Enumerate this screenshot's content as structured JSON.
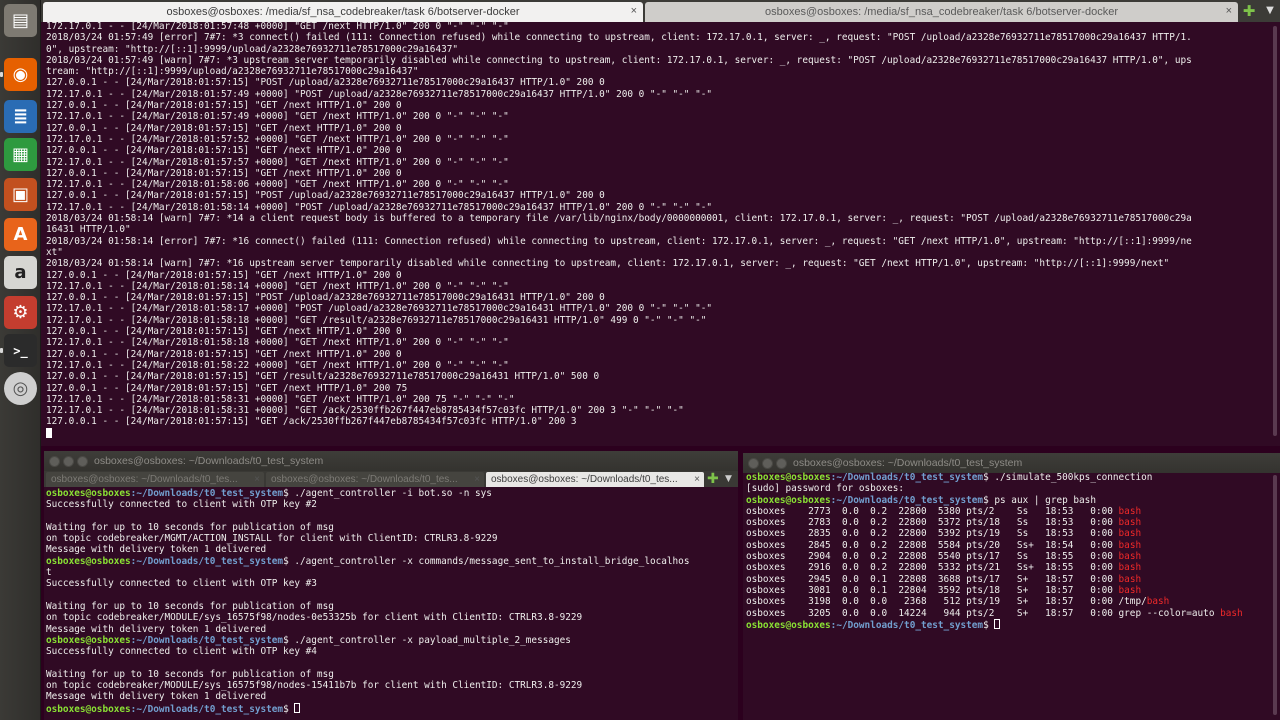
{
  "launcher": {
    "items": [
      {
        "icon": "file-manager-icon",
        "color": "#7e7a72",
        "glyph": "▤"
      },
      {
        "icon": "firefox-icon",
        "color": "#e66000",
        "glyph": "◉"
      },
      {
        "icon": "writer-icon",
        "color": "#2a6cb4",
        "glyph": "≣"
      },
      {
        "icon": "calc-icon",
        "color": "#2e9a3f",
        "glyph": "▦"
      },
      {
        "icon": "impress-icon",
        "color": "#c2501f",
        "glyph": "▣"
      },
      {
        "icon": "software-center-icon",
        "color": "#e8641b",
        "glyph": "A"
      },
      {
        "icon": "amazon-icon",
        "color": "#d6d6d2",
        "glyph": "a"
      },
      {
        "icon": "system-settings-icon",
        "color": "#c43d2f",
        "glyph": "⚙"
      },
      {
        "icon": "terminal-icon",
        "color": "#2b2b2b",
        "glyph": ">_"
      },
      {
        "icon": "dvd-icon",
        "color": "#cfcfcf",
        "glyph": "◎"
      }
    ]
  },
  "top_window": {
    "tabs": [
      {
        "label": "osboxes@osboxes: /media/sf_nsa_codebreaker/task 6/botserver-docker",
        "close": "×"
      },
      {
        "label": "osboxes@osboxes: /media/sf_nsa_codebreaker/task 6/botserver-docker",
        "close": "×"
      }
    ],
    "add_glyph": "✚",
    "menu_glyph": "▼",
    "lines": [
      "172.17.0.1 - - [24/Mar/2018:01:57:48 +0000] \"GET /next HTTP/1.0\" 200 0 \"-\" \"-\" \"-\"",
      "2018/03/24 01:57:49 [error] 7#7: *3 connect() failed (111: Connection refused) while connecting to upstream, client: 172.17.0.1, server: _, request: \"POST /upload/a2328e76932711e78517000c29a16437 HTTP/1.",
      "0\", upstream: \"http://[::1]:9999/upload/a2328e76932711e78517000c29a16437\"",
      "2018/03/24 01:57:49 [warn] 7#7: *3 upstream server temporarily disabled while connecting to upstream, client: 172.17.0.1, server: _, request: \"POST /upload/a2328e76932711e78517000c29a16437 HTTP/1.0\", ups",
      "tream: \"http://[::1]:9999/upload/a2328e76932711e78517000c29a16437\"",
      "127.0.0.1 - - [24/Mar/2018:01:57:15] \"POST /upload/a2328e76932711e78517000c29a16437 HTTP/1.0\" 200 0",
      "172.17.0.1 - - [24/Mar/2018:01:57:49 +0000] \"POST /upload/a2328e76932711e78517000c29a16437 HTTP/1.0\" 200 0 \"-\" \"-\" \"-\"",
      "127.0.0.1 - - [24/Mar/2018:01:57:15] \"GET /next HTTP/1.0\" 200 0",
      "172.17.0.1 - - [24/Mar/2018:01:57:49 +0000] \"GET /next HTTP/1.0\" 200 0 \"-\" \"-\" \"-\"",
      "127.0.0.1 - - [24/Mar/2018:01:57:15] \"GET /next HTTP/1.0\" 200 0",
      "172.17.0.1 - - [24/Mar/2018:01:57:52 +0000] \"GET /next HTTP/1.0\" 200 0 \"-\" \"-\" \"-\"",
      "127.0.0.1 - - [24/Mar/2018:01:57:15] \"GET /next HTTP/1.0\" 200 0",
      "172.17.0.1 - - [24/Mar/2018:01:57:57 +0000] \"GET /next HTTP/1.0\" 200 0 \"-\" \"-\" \"-\"",
      "127.0.0.1 - - [24/Mar/2018:01:57:15] \"GET /next HTTP/1.0\" 200 0",
      "172.17.0.1 - - [24/Mar/2018:01:58:06 +0000] \"GET /next HTTP/1.0\" 200 0 \"-\" \"-\" \"-\"",
      "127.0.0.1 - - [24/Mar/2018:01:57:15] \"POST /upload/a2328e76932711e78517000c29a16437 HTTP/1.0\" 200 0",
      "172.17.0.1 - - [24/Mar/2018:01:58:14 +0000] \"POST /upload/a2328e76932711e78517000c29a16437 HTTP/1.0\" 200 0 \"-\" \"-\" \"-\"",
      "2018/03/24 01:58:14 [warn] 7#7: *14 a client request body is buffered to a temporary file /var/lib/nginx/body/0000000001, client: 172.17.0.1, server: _, request: \"POST /upload/a2328e76932711e78517000c29a",
      "16431 HTTP/1.0\"",
      "2018/03/24 01:58:14 [error] 7#7: *16 connect() failed (111: Connection refused) while connecting to upstream, client: 172.17.0.1, server: _, request: \"GET /next HTTP/1.0\", upstream: \"http://[::1]:9999/ne",
      "xt\"",
      "2018/03/24 01:58:14 [warn] 7#7: *16 upstream server temporarily disabled while connecting to upstream, client: 172.17.0.1, server: _, request: \"GET /next HTTP/1.0\", upstream: \"http://[::1]:9999/next\"",
      "127.0.0.1 - - [24/Mar/2018:01:57:15] \"GET /next HTTP/1.0\" 200 0",
      "172.17.0.1 - - [24/Mar/2018:01:58:14 +0000] \"GET /next HTTP/1.0\" 200 0 \"-\" \"-\" \"-\"",
      "127.0.0.1 - - [24/Mar/2018:01:57:15] \"POST /upload/a2328e76932711e78517000c29a16431 HTTP/1.0\" 200 0",
      "172.17.0.1 - - [24/Mar/2018:01:58:17 +0000] \"POST /upload/a2328e76932711e78517000c29a16431 HTTP/1.0\" 200 0 \"-\" \"-\" \"-\"",
      "172.17.0.1 - - [24/Mar/2018:01:58:18 +0000] \"GET /result/a2328e76932711e78517000c29a16431 HTTP/1.0\" 499 0 \"-\" \"-\" \"-\"",
      "127.0.0.1 - - [24/Mar/2018:01:57:15] \"GET /next HTTP/1.0\" 200 0",
      "172.17.0.1 - - [24/Mar/2018:01:58:18 +0000] \"GET /next HTTP/1.0\" 200 0 \"-\" \"-\" \"-\"",
      "127.0.0.1 - - [24/Mar/2018:01:57:15] \"GET /next HTTP/1.0\" 200 0",
      "172.17.0.1 - - [24/Mar/2018:01:58:22 +0000] \"GET /next HTTP/1.0\" 200 0 \"-\" \"-\" \"-\"",
      "127.0.0.1 - - [24/Mar/2018:01:57:15] \"GET /result/a2328e76932711e78517000c29a16431 HTTP/1.0\" 500 0",
      "127.0.0.1 - - [24/Mar/2018:01:57:15] \"GET /next HTTP/1.0\" 200 75",
      "172.17.0.1 - - [24/Mar/2018:01:58:31 +0000] \"GET /next HTTP/1.0\" 200 75 \"-\" \"-\" \"-\"",
      "172.17.0.1 - - [24/Mar/2018:01:58:31 +0000] \"GET /ack/2530ffb267f447eb8785434f57c03fc HTTP/1.0\" 200 3 \"-\" \"-\" \"-\"",
      "127.0.0.1 - - [24/Mar/2018:01:57:15] \"GET /ack/2530ffb267f447eb8785434f57c03fc HTTP/1.0\" 200 3"
    ]
  },
  "bottom_left": {
    "title": "osboxes@osboxes: ~/Downloads/t0_test_system",
    "tabs": [
      {
        "label": "osboxes@osboxes: ~/Downloads/t0_tes...",
        "close": "×"
      },
      {
        "label": "osboxes@osboxes: ~/Downloads/t0_tes...",
        "close": "×"
      },
      {
        "label": "osboxes@osboxes: ~/Downloads/t0_tes...",
        "close": "×"
      }
    ],
    "add_glyph": "✚",
    "menu_glyph": "▼",
    "prompt_user": "osboxes@osboxes",
    "prompt_path": ":~/Downloads/t0_test_system",
    "prompt_sign": "$ ",
    "lines": [
      {
        "type": "cmd",
        "text": "./agent_controller -i bot.so -n sys"
      },
      {
        "type": "out",
        "text": "Successfully connected to client with OTP key #2"
      },
      {
        "type": "out",
        "text": ""
      },
      {
        "type": "out",
        "text": "Waiting for up to 10 seconds for publication of msg"
      },
      {
        "type": "out",
        "text": "on topic codebreaker/MGMT/ACTION_INSTALL for client with ClientID: CTRLR3.8-9229"
      },
      {
        "type": "out",
        "text": "Message with delivery token 1 delivered"
      },
      {
        "type": "cmd",
        "text": "./agent_controller -x commands/message_sent_to_install_bridge_localhos"
      },
      {
        "type": "out",
        "text": "t"
      },
      {
        "type": "out",
        "text": "Successfully connected to client with OTP key #3"
      },
      {
        "type": "out",
        "text": ""
      },
      {
        "type": "out",
        "text": "Waiting for up to 10 seconds for publication of msg"
      },
      {
        "type": "out",
        "text": "on topic codebreaker/MODULE/sys_16575f98/nodes-0e53325b for client with ClientID: CTRLR3.8-9229"
      },
      {
        "type": "out",
        "text": "Message with delivery token 1 delivered"
      },
      {
        "type": "cmd",
        "text": "./agent_controller -x payload_multiple_2_messages"
      },
      {
        "type": "out",
        "text": "Successfully connected to client with OTP key #4"
      },
      {
        "type": "out",
        "text": ""
      },
      {
        "type": "out",
        "text": "Waiting for up to 10 seconds for publication of msg"
      },
      {
        "type": "out",
        "text": "on topic codebreaker/MODULE/sys_16575f98/nodes-15411b7b for client with ClientID: CTRLR3.8-9229"
      },
      {
        "type": "out",
        "text": "Message with delivery token 1 delivered"
      },
      {
        "type": "cmd",
        "text": ""
      }
    ]
  },
  "bottom_right": {
    "title": "osboxes@osboxes: ~/Downloads/t0_test_system",
    "prompt_user": "osboxes@osboxes",
    "prompt_path": ":~/Downloads/t0_test_system",
    "prompt_sign": "$ ",
    "lines": [
      {
        "type": "cmd",
        "text": "./simulate_500kps_connection"
      },
      {
        "type": "out",
        "text": "[sudo] password for osboxes:"
      },
      {
        "type": "cmd",
        "text": "ps aux | grep bash"
      },
      {
        "type": "ps",
        "text": "osboxes    2773  0.0  0.2  22800  5380 pts/2    Ss   18:53   0:00 ",
        "hl": "bash"
      },
      {
        "type": "ps",
        "text": "osboxes    2783  0.0  0.2  22800  5372 pts/18   Ss   18:53   0:00 ",
        "hl": "bash"
      },
      {
        "type": "ps",
        "text": "osboxes    2835  0.0  0.2  22800  5392 pts/19   Ss   18:53   0:00 ",
        "hl": "bash"
      },
      {
        "type": "ps",
        "text": "osboxes    2845  0.0  0.2  22808  5584 pts/20   Ss+  18:54   0:00 ",
        "hl": "bash"
      },
      {
        "type": "ps",
        "text": "osboxes    2904  0.0  0.2  22808  5540 pts/17   Ss   18:55   0:00 ",
        "hl": "bash"
      },
      {
        "type": "ps",
        "text": "osboxes    2916  0.0  0.2  22800  5332 pts/21   Ss+  18:55   0:00 ",
        "hl": "bash"
      },
      {
        "type": "ps",
        "text": "osboxes    2945  0.0  0.1  22808  3688 pts/17   S+   18:57   0:00 ",
        "hl": "bash"
      },
      {
        "type": "ps",
        "text": "osboxes    3081  0.0  0.1  22804  3592 pts/18   S+   18:57   0:00 ",
        "hl": "bash"
      },
      {
        "type": "ps",
        "text": "osboxes    3198  0.0  0.0   2368   512 pts/19   S+   18:57   0:00 /tmp/",
        "hl": "bash"
      },
      {
        "type": "ps",
        "text": "osboxes    3205  0.0  0.0  14224   944 pts/2    S+   18:57   0:00 grep --color=auto ",
        "hl": "bash"
      },
      {
        "type": "cmd",
        "text": ""
      }
    ]
  }
}
